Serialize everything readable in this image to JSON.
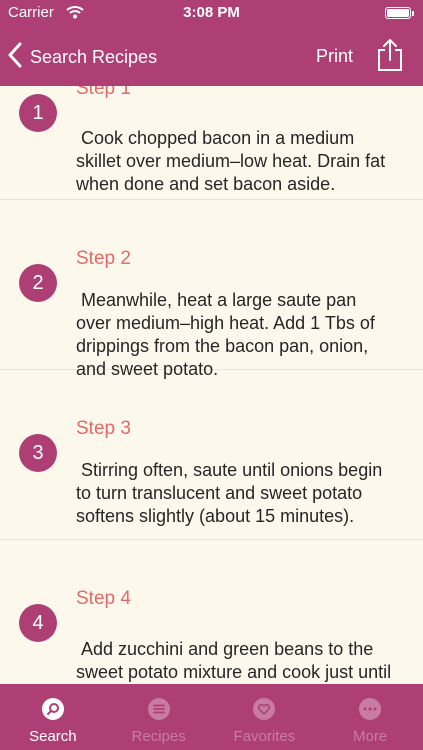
{
  "status_bar": {
    "carrier": "Carrier",
    "time": "3:08 PM"
  },
  "navbar": {
    "back_label": "Search Recipes",
    "print_label": "Print",
    "share_icon": "share-icon"
  },
  "steps": [
    {
      "number": "1",
      "title": "Step 1",
      "text": " Cook chopped bacon in a medium skillet over medium–low heat. Drain fat when done and set bacon aside."
    },
    {
      "number": "2",
      "title": "Step 2",
      "text": " Meanwhile, heat a large saute pan over medium–high heat. Add 1 Tbs of drippings from the bacon pan, onion, and sweet potato."
    },
    {
      "number": "3",
      "title": "Step 3",
      "text": " Stirring often, saute until onions begin to turn translucent and sweet potato softens slightly (about 15 minutes)."
    },
    {
      "number": "4",
      "title": "Step 4",
      "text": " Add zucchini and green beans to the sweet potato mixture and cook just until"
    }
  ],
  "tabbar": {
    "tabs": [
      {
        "label": "Search",
        "icon": "search-icon",
        "active": true
      },
      {
        "label": "Recipes",
        "icon": "list-icon",
        "active": false
      },
      {
        "label": "Favorites",
        "icon": "heart-icon",
        "active": false
      },
      {
        "label": "More",
        "icon": "more-icon",
        "active": false
      }
    ]
  },
  "colors": {
    "brand": "#ae3f75",
    "background": "#fdf8ec",
    "step_title": "#e26a6a",
    "tab_inactive": "#c97ca1"
  }
}
